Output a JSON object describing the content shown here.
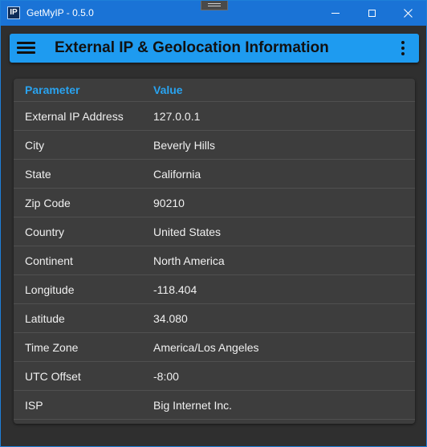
{
  "window": {
    "icon_text": "IP",
    "title": "GetMyIP - 0.5.0"
  },
  "appbar": {
    "title": "External IP & Geolocation Information"
  },
  "table": {
    "headers": [
      "Parameter",
      "Value"
    ],
    "rows": [
      {
        "param": "External IP Address",
        "value": "127.0.0.1"
      },
      {
        "param": "City",
        "value": "Beverly Hills"
      },
      {
        "param": "State",
        "value": "California"
      },
      {
        "param": "Zip Code",
        "value": "90210"
      },
      {
        "param": "Country",
        "value": "United States"
      },
      {
        "param": "Continent",
        "value": "North America"
      },
      {
        "param": "Longitude",
        "value": "-118.404"
      },
      {
        "param": "Latitude",
        "value": "34.080"
      },
      {
        "param": "Time Zone",
        "value": "America/Los Angeles"
      },
      {
        "param": "UTC Offset",
        "value": "-8:00"
      },
      {
        "param": "ISP",
        "value": "Big Internet Inc."
      }
    ]
  },
  "colors": {
    "titlebar": "#1a73d6",
    "appbar": "#1e9bf0",
    "header_text": "#29a3f0",
    "card": "#3d3d3d"
  },
  "icons": {
    "app": "ip-app-icon",
    "menu": "hamburger-menu-icon",
    "more": "more-vertical-icon",
    "minimize": "minimize-icon",
    "maximize": "maximize-icon",
    "close": "close-icon"
  }
}
